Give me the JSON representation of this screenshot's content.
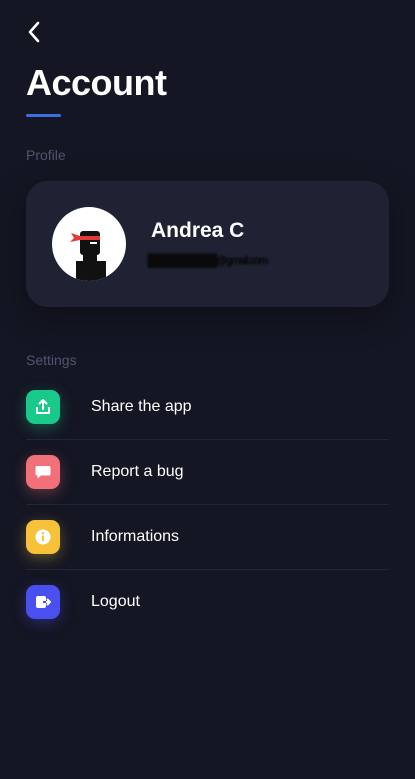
{
  "header": {
    "back_icon": "chevron-left-icon",
    "title": "Account"
  },
  "accent_color": "#3b6fe0",
  "profile": {
    "section_label": "Profile",
    "name": "Andrea C",
    "email": "██████████@gmail.com"
  },
  "settings": {
    "section_label": "Settings",
    "items": [
      {
        "label": "Share the app",
        "icon": "share-icon",
        "color": "#19c98a"
      },
      {
        "label": "Report a bug",
        "icon": "chat-bubble-icon",
        "color": "#f2707a"
      },
      {
        "label": "Informations",
        "icon": "info-icon",
        "color": "#f5c23a"
      },
      {
        "label": "Logout",
        "icon": "logout-icon",
        "color": "#4a4ff0"
      }
    ]
  }
}
